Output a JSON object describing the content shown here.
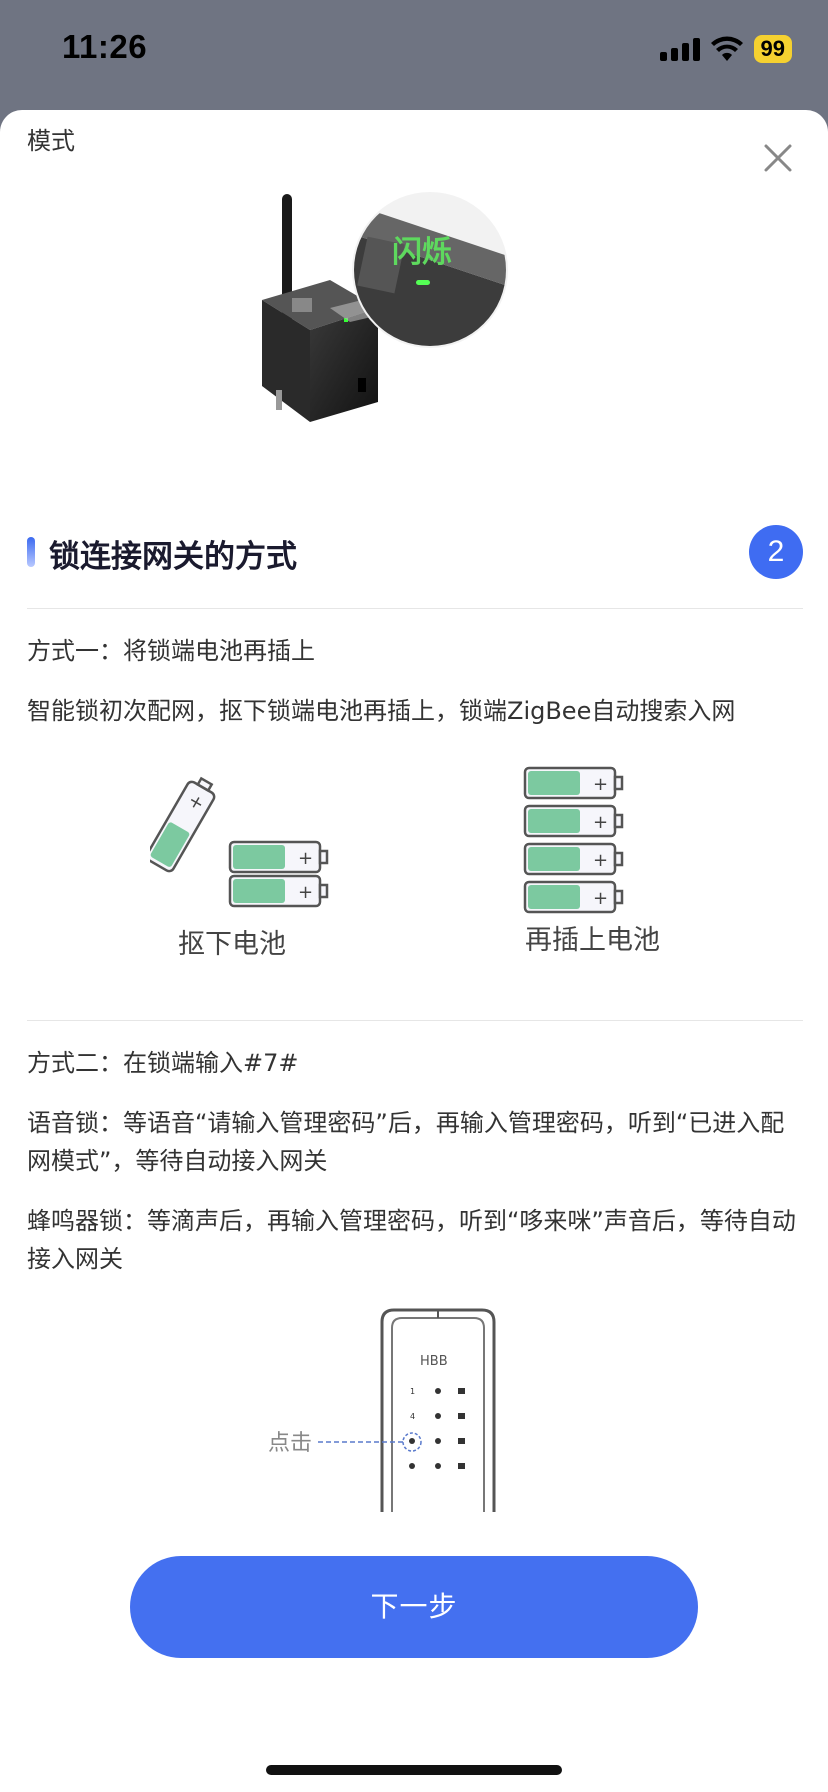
{
  "status_bar": {
    "time": "11:26",
    "battery": "99"
  },
  "sheet": {
    "cut_text": "模式",
    "gateway_badge": "闪烁",
    "section": {
      "title": "锁连接网关的方式",
      "step": "2"
    },
    "method1": {
      "title": "方式一：将锁端电池再插上",
      "desc": "智能锁初次配网，抠下锁端电池再插上，锁端ZigBee自动搜索入网",
      "caption_remove": "抠下电池",
      "caption_insert": "再插上电池"
    },
    "method2": {
      "title": "方式二：在锁端输入#7#",
      "voice_lock": "语音锁：等语音“请输入管理密码”后，再输入管理密码，听到“已进入配网模式”，等待自动接入网关",
      "buzzer_lock": "蜂鸣器锁：等滴声后，再输入管理密码，听到“哆来咪”声音后，等待自动接入网关",
      "click_label": "点击"
    },
    "next_button": "下一步"
  },
  "colors": {
    "accent": "#4470f0",
    "battery_green": "#7cc9a0"
  }
}
